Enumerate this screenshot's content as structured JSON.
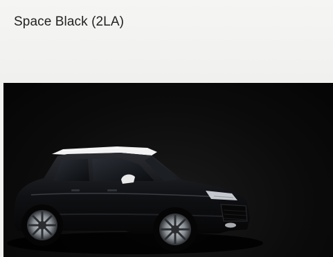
{
  "color_option": {
    "name": "Space Black (2LA)"
  },
  "image": {
    "background_color": "#0b0b0b",
    "car_body_color": "#0e0f12",
    "car_roof_color": "#f2f2f2"
  }
}
